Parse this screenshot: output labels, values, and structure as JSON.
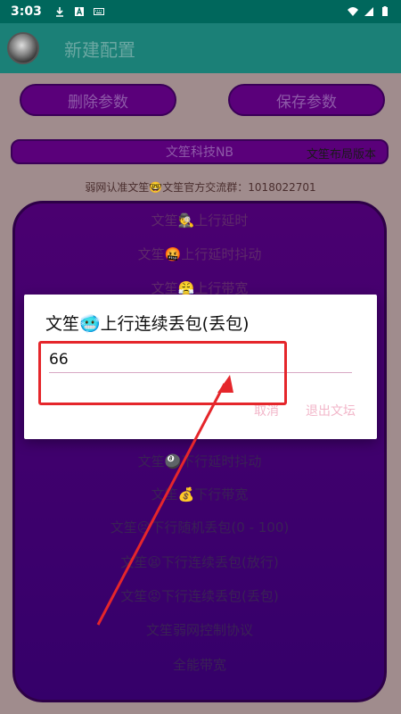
{
  "status_bar": {
    "time": "3:03"
  },
  "app_bar": {
    "title": "新建配置"
  },
  "buttons": {
    "delete": "删除参数",
    "save": "保存参数"
  },
  "main_bar": {
    "label": "文笙科技NB",
    "layout_version": "文笙布局版本"
  },
  "group_text": "弱网认准文笙🤓文笙官方交流群：1018022701",
  "list": {
    "items_top": [
      "文笙🕵️上行延时",
      "文笙🤬上行延时抖动",
      "文笙😤上行带宽"
    ],
    "items_bottom": [
      "文笙🎱下行延时抖动",
      "文笙💰下行带宽",
      "文笙😣下行随机丢包(0 - 100)",
      "文笙😫下行连续丢包(放行)",
      "文笙😡下行连续丢包(丢包)",
      "文笙弱网控制协议",
      "全能带宽"
    ]
  },
  "dialog": {
    "title": "文笙🥶上行连续丢包(丢包)",
    "value": "66",
    "cancel": "取消",
    "exit": "退出文坛"
  },
  "colors": {
    "status_bar": "#00675c",
    "app_bar": "#1b8077",
    "annotation": "#e5262b",
    "list_bg": "#4a0070"
  }
}
